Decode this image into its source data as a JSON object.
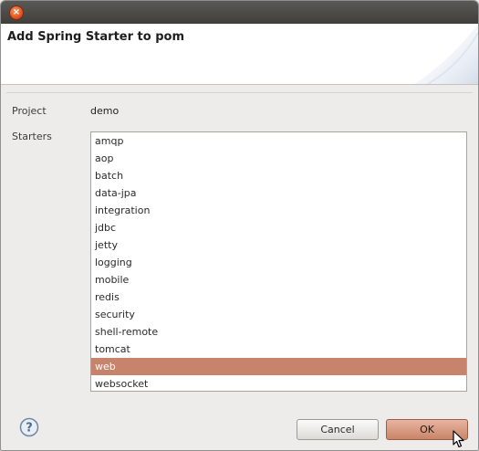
{
  "titlebar": {
    "close_glyph": "×"
  },
  "header": {
    "title": "Add Spring Starter to pom"
  },
  "form": {
    "project_label": "Project",
    "project_value": "demo",
    "starters_label": "Starters"
  },
  "starters": {
    "items": [
      "amqp",
      "aop",
      "batch",
      "data-jpa",
      "integration",
      "jdbc",
      "jetty",
      "logging",
      "mobile",
      "redis",
      "security",
      "shell-remote",
      "tomcat",
      "web",
      "websocket"
    ],
    "selected": "web"
  },
  "buttons": {
    "cancel": "Cancel",
    "ok": "OK"
  },
  "icons": {
    "help": "help-icon",
    "close": "close-icon",
    "cursor": "mouse-cursor-icon"
  },
  "colors": {
    "selection": "#c7836b",
    "ok_button": "#d69479",
    "close_button": "#e2531f"
  }
}
